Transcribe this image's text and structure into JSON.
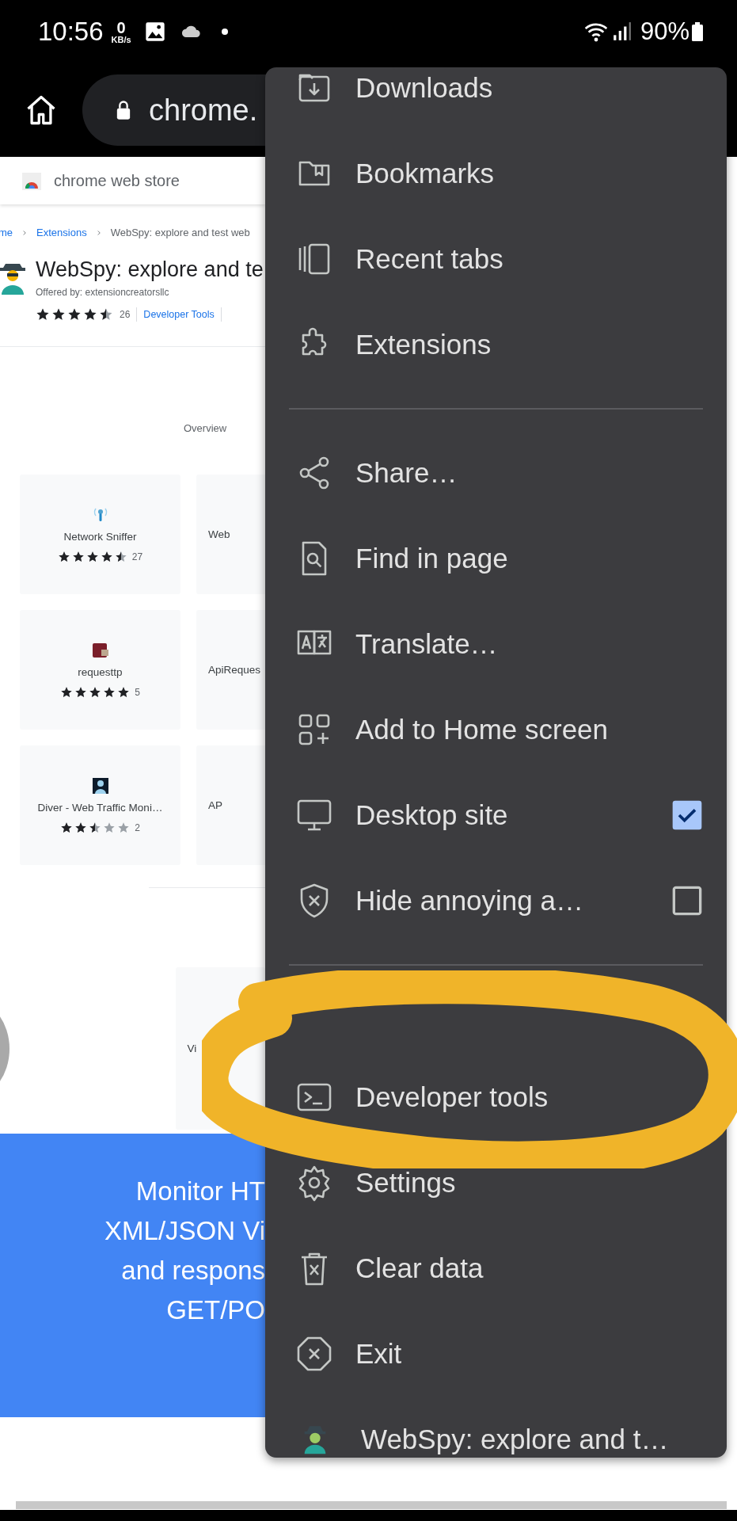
{
  "status_bar": {
    "time": "10:56",
    "speed_value": "0",
    "speed_unit": "KB/s",
    "battery": "90%"
  },
  "toolbar": {
    "url": "chrome."
  },
  "page": {
    "store_name": "chrome web store",
    "breadcrumbs": [
      "me",
      "Extensions",
      "WebSpy: explore and test web"
    ],
    "title": "WebSpy: explore and te",
    "offered_by": "Offered by: extensioncreatorsllc",
    "stars": 4.5,
    "rating_count": "26",
    "category": "Developer Tools",
    "tab": "Overview",
    "related": [
      {
        "kind": "full",
        "name": "Network Sniffer",
        "stars": 4.5,
        "count": "27"
      },
      {
        "kind": "cut",
        "name": "Web"
      },
      {
        "kind": "full",
        "name": "requesttp",
        "stars": 5,
        "count": "5"
      },
      {
        "kind": "cut",
        "name": "ApiReques"
      },
      {
        "kind": "full",
        "name": "Diver - Web Traffic Moni…",
        "stars": 2.5,
        "count": "2"
      },
      {
        "kind": "cut",
        "name": "AP"
      }
    ],
    "more_card": {
      "name": "Vi"
    },
    "banner_lines": [
      "Monitor HT",
      "XML/JSON Vi",
      "and respons",
      "GET/PO"
    ]
  },
  "menu": {
    "groups": [
      [
        {
          "kind": "plain",
          "label": "Downloads"
        },
        {
          "kind": "plain",
          "label": "Bookmarks"
        },
        {
          "kind": "plain",
          "label": "Recent tabs"
        },
        {
          "kind": "plain",
          "label": "Extensions"
        }
      ],
      [
        {
          "kind": "plain",
          "label": "Share…"
        },
        {
          "kind": "plain",
          "label": "Find in page"
        },
        {
          "kind": "plain",
          "label": "Translate…"
        },
        {
          "kind": "plain",
          "label": "Add to Home screen"
        },
        {
          "kind": "checkbox",
          "label": "Desktop site",
          "checked": true
        },
        {
          "kind": "checkbox",
          "label": "Hide annoying a…",
          "checked": false
        }
      ],
      [
        {
          "kind": "plain",
          "label": "Developer tools"
        },
        {
          "kind": "plain",
          "label": "Settings"
        },
        {
          "kind": "plain",
          "label": "Clear data"
        },
        {
          "kind": "plain",
          "label": "Exit"
        },
        {
          "kind": "app",
          "label": "WebSpy: explore and t…"
        }
      ]
    ]
  }
}
